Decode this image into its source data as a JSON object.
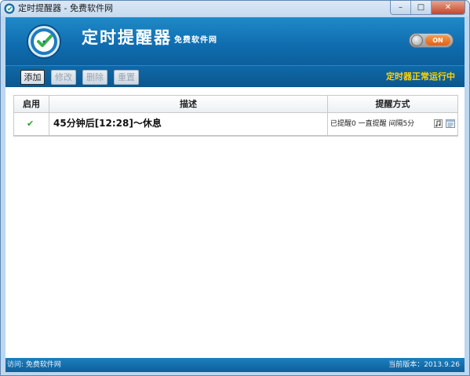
{
  "window": {
    "title": "定时提醒器 - 免费软件网",
    "minimize": "–",
    "maximize": "□",
    "close": "✕"
  },
  "banner": {
    "app_name": "定时提醒器",
    "subtitle": "免费软件网",
    "toggle_label": "ON"
  },
  "toolbar": {
    "add_label": "添加",
    "edit_label": "修改",
    "delete_label": "删除",
    "reset_label": "重置",
    "status": "定时器正常运行中"
  },
  "table": {
    "columns": [
      "启用",
      "描述",
      "提醒方式"
    ],
    "rows": [
      {
        "enabled": "✔",
        "description": "45分钟后[12:28]～休息",
        "mode": "已提醒0  一直提醒  间隔5分"
      }
    ]
  },
  "statusbar": {
    "left": "访问: 免费软件网",
    "right": "当前版本：2013.9.26"
  },
  "colors": {
    "banner": "#0f6cae",
    "status_text": "#ffd400",
    "check": "#2f9a2f"
  }
}
